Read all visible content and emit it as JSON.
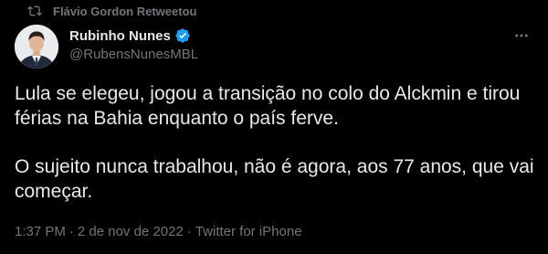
{
  "retweet": {
    "icon": "retweet-icon",
    "text": "Flávio Gordon Retweetou"
  },
  "author": {
    "display_name": "Rubinho Nunes",
    "handle": "@RubensNunesMBL",
    "verified": true,
    "verified_icon": "verified-badge-icon",
    "avatar_icon": "avatar"
  },
  "more_icon": "more-icon",
  "tweet": {
    "paragraphs": [
      "Lula se elegeu, jogou a transição no colo do Alckmin e tirou férias na Bahia enquanto o país ferve.",
      "O sujeito nunca trabalhou, não é agora, aos 77 anos, que vai começar."
    ]
  },
  "meta": {
    "time": "1:37 PM",
    "separator": "·",
    "date": "2 de nov de 2022",
    "source": "Twitter for iPhone"
  },
  "colors": {
    "background": "#000000",
    "text_primary": "#e7e9ea",
    "text_secondary": "#71767b",
    "verified": "#1d9bf0"
  }
}
